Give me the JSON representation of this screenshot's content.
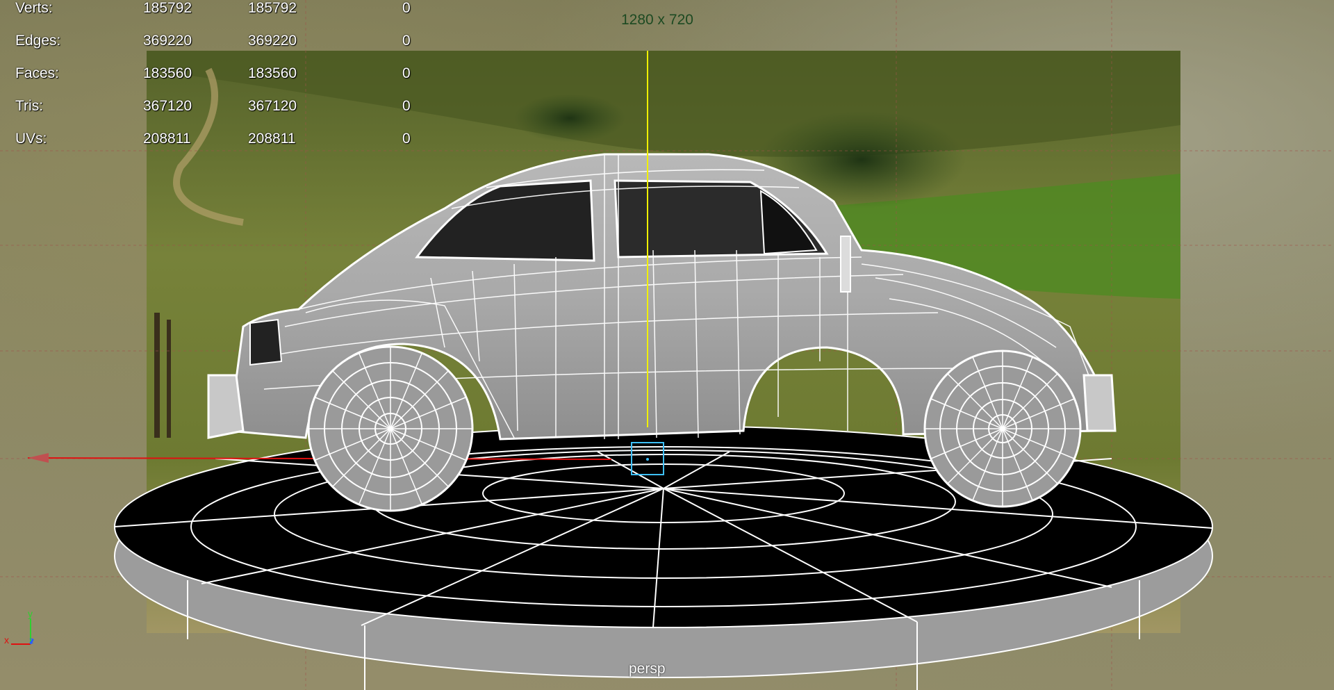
{
  "viewport": {
    "resolution_label": "1280 x 720",
    "camera_name": "persp"
  },
  "heads_up_display": {
    "rows": [
      {
        "label": "Verts:",
        "values": [
          "185792",
          "185792",
          "0"
        ]
      },
      {
        "label": "Edges:",
        "values": [
          "369220",
          "369220",
          "0"
        ]
      },
      {
        "label": "Faces:",
        "values": [
          "183560",
          "183560",
          "0"
        ]
      },
      {
        "label": "Tris:",
        "values": [
          "367120",
          "367120",
          "0"
        ]
      },
      {
        "label": "UVs:",
        "values": [
          "208811",
          "208811",
          "0"
        ]
      }
    ]
  },
  "axis_indicator": {
    "x": "x",
    "y": "y",
    "z": "z"
  },
  "colors": {
    "x_axis": "#e01010",
    "y_axis": "#2fd02f",
    "z_axis": "#2a5cff",
    "camera_center_line": "#f0f000",
    "resolution_gate_text": "#1d4a22",
    "wireframe": "#ffffff",
    "manipulator": "#3ec0ff"
  }
}
